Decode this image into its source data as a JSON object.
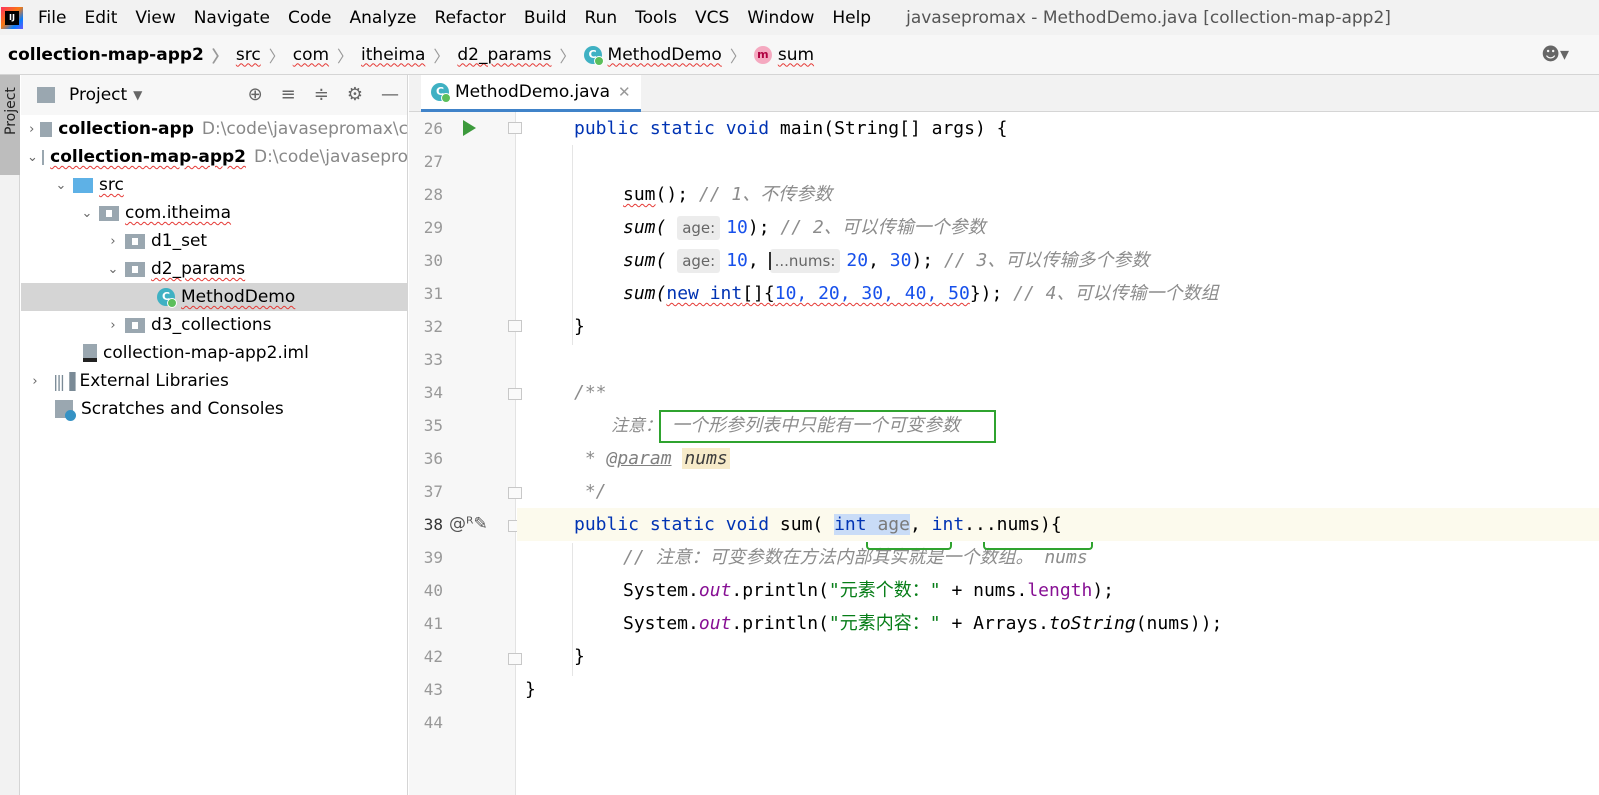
{
  "menu": {
    "items": [
      "File",
      "Edit",
      "View",
      "Navigate",
      "Code",
      "Analyze",
      "Refactor",
      "Build",
      "Run",
      "Tools",
      "VCS",
      "Window",
      "Help"
    ],
    "window_title": "javasepromax - MethodDemo.java [collection-map-app2]"
  },
  "breadcrumb": {
    "project": "collection-map-app2",
    "src": "src",
    "com": "com",
    "itheima": "itheima",
    "d2_params": "d2_params",
    "class": "MethodDemo",
    "method": "sum"
  },
  "stripe": {
    "project_label": "Project"
  },
  "project_panel": {
    "title": "Project",
    "tree": [
      {
        "label": "collection-app",
        "path": "D:\\code\\javasepromax\\c"
      },
      {
        "label": "collection-map-app2",
        "path": "D:\\code\\javasepro"
      },
      {
        "label": "src"
      },
      {
        "label": "com.itheima"
      },
      {
        "label": "d1_set"
      },
      {
        "label": "d2_params"
      },
      {
        "label": "MethodDemo"
      },
      {
        "label": "d3_collections"
      },
      {
        "label": "collection-map-app2.iml"
      },
      {
        "label": "External Libraries"
      },
      {
        "label": "Scratches and Consoles"
      }
    ]
  },
  "editor": {
    "tab_label": "MethodDemo.java",
    "line_numbers": [
      "26",
      "27",
      "28",
      "29",
      "30",
      "31",
      "32",
      "33",
      "34",
      "35",
      "36",
      "37",
      "38",
      "39",
      "40",
      "41",
      "42",
      "43",
      "44"
    ],
    "code": {
      "l26_a": "public static void ",
      "l26_b": "main(String[] args) {",
      "l28_a": "sum",
      "l28_b": "(); ",
      "l28_c": "// 1、不传参数",
      "l29_a": "sum(",
      "l29_hint": "age:",
      "l29_b": "10",
      "l29_c": "); ",
      "l29_d": "// 2、可以传输一个参数",
      "l30_a": "sum(",
      "l30_hint1": "age:",
      "l30_b": "10",
      "l30_c": ", ",
      "l30_hint2": "...nums:",
      "l30_d": "20",
      "l30_e": ", ",
      "l30_f": "30",
      "l30_g": "); ",
      "l30_h": "// 3、可以传输多个参数",
      "l31_a": "sum(",
      "l31_b": "new int",
      "l31_c": "[]{",
      "l31_d": "10, 20, 30, 40, 50",
      "l31_e": "}); ",
      "l31_f": "// 4、可以传输一个数组",
      "l32": "}",
      "l34": "/**",
      "l35_a": "注意：",
      "l35_b": "一个形参列表中只能有一个可变参数",
      "l36_a": " * ",
      "l36_b": "@param",
      "l36_c": "nums",
      "l37": " */",
      "l38_a": "public static void ",
      "l38_b": "sum( ",
      "l38_c": "int",
      "l38_d": " age",
      "l38_e": ", ",
      "l38_f": "int",
      "l38_g": "...nums){",
      "l39": "// 注意：可变参数在方法内部其实就是一个数组。 nums",
      "l40_a": "System.",
      "l40_b": "out",
      "l40_c": ".println(",
      "l40_d": "\"元素个数：\"",
      "l40_e": " + nums.",
      "l40_f": "length",
      "l40_g": ");",
      "l41_a": "System.",
      "l41_b": "out",
      "l41_c": ".println(",
      "l41_d": "\"元素内容：\"",
      "l41_e": " + Arrays.",
      "l41_f": "toString",
      "l41_g": "(nums));",
      "l42": "}",
      "l43": "}"
    }
  },
  "colors": {
    "keyword": "#0033b3",
    "number": "#1750eb",
    "comment": "#8c8c8c",
    "string": "#067d17",
    "annotation_box": "#2fa32f"
  }
}
